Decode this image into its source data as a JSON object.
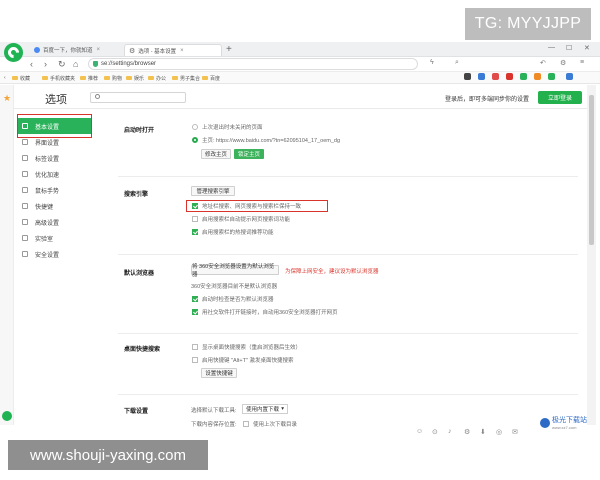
{
  "watermarks": {
    "top": "TG: MYYJJPP",
    "bottom": "www.shouji-yaxing.com"
  },
  "tabs": [
    {
      "label": "百度一下，你就知道"
    },
    {
      "label": "选项 - 基本设置"
    }
  ],
  "address_bar": {
    "url": "se://settings/browser"
  },
  "bookmarks": [
    "收藏",
    "手机收藏夹",
    "推荐",
    "购物",
    "娱乐",
    "办公",
    "男子集合",
    "百度"
  ],
  "settings": {
    "title": "选项",
    "search_placeholder": "",
    "login_tip": "登录后，即可多端同步你的设置",
    "login_button": "立即登录"
  },
  "sidebar": {
    "items": [
      {
        "label": "基本设置",
        "active": true
      },
      {
        "label": "界面设置"
      },
      {
        "label": "标签设置"
      },
      {
        "label": "优化加速"
      },
      {
        "label": "鼠标手势"
      },
      {
        "label": "快捷键"
      },
      {
        "label": "高级设置"
      },
      {
        "label": "实验室"
      },
      {
        "label": "安全设置"
      }
    ]
  },
  "startup": {
    "title": "启动时打开",
    "opt_restore": "上次退出时未关闭的页面",
    "opt_home": "主页: https://www.baidu.com/?tn=62095104_17_oem_dg",
    "btn_edit": "修改主页",
    "btn_lock": "锁定主页"
  },
  "search_engine": {
    "title": "搜索引擎",
    "btn_manage": "管理搜索引擎",
    "opt_sync": "地址栏搜索、网页搜索与搜索栏保持一致",
    "opt_auto": "启用搜索栏自动提示网页搜索词功能",
    "opt_hot": "启用搜索栏的热搜词推荐功能"
  },
  "default_browser": {
    "title": "默认浏览器",
    "btn_set": "将 360安全浏览器设置为默认浏览器",
    "warn": "为保障上网安全，建议设为默认浏览器",
    "status": "360安全浏览器目前不是默认浏览器",
    "opt_check": "启动时检查是否为默认浏览器",
    "opt_open": "用社交软件打开链接时，自动用360安全浏览器打开网页"
  },
  "desktop_search": {
    "title": "桌面快捷搜索",
    "opt_show": "显示桌面快捷搜索（重启浏览器后生效）",
    "opt_hotkey": "启用快捷键 \"Alt+T\" 激发桌面快捷搜索",
    "btn_setup": "设置快捷键"
  },
  "downloads": {
    "title": "下载设置",
    "label_tool": "选择默认下载工具:",
    "select_tool": "使用内置下载",
    "label_dir": "下载内容保存位置:",
    "opt_last": "使用上次下载目录"
  },
  "corner_logo": {
    "name": "极光下载站",
    "sub": "www.xz7.com"
  },
  "colors": {
    "accent": "#2ab25a",
    "highlight": "#d9342b"
  }
}
